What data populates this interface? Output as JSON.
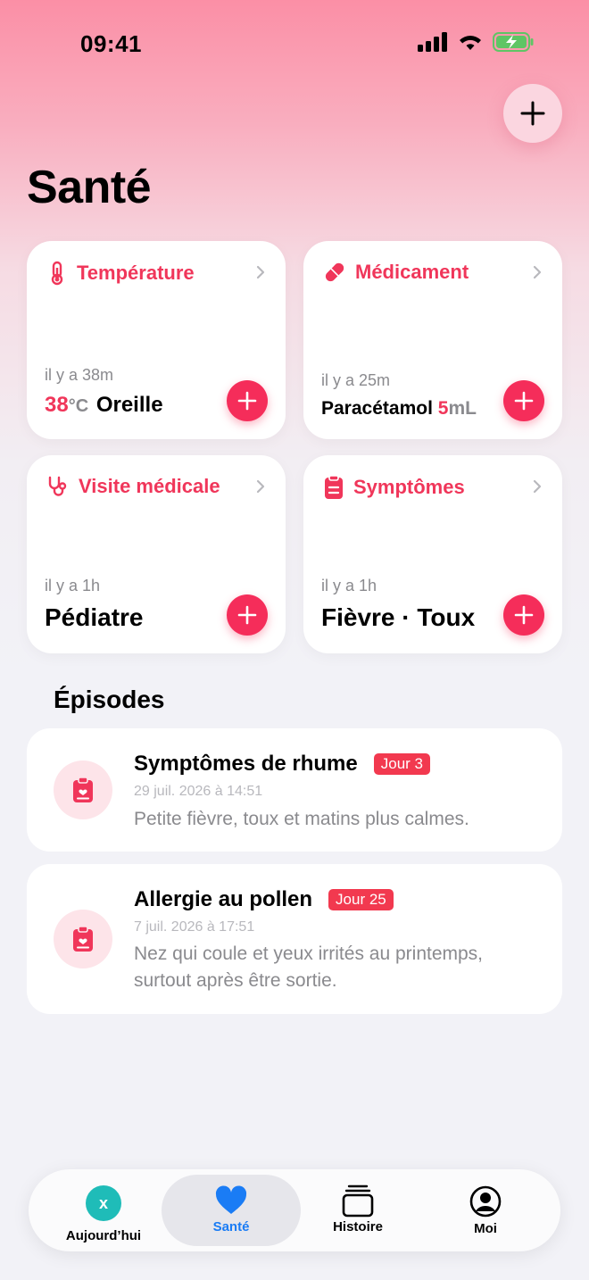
{
  "status_bar": {
    "time": "09:41"
  },
  "page": {
    "title": "Santé"
  },
  "cards": [
    {
      "label": "Température",
      "ago": "il y a 38m",
      "value_number": "38",
      "value_unit": "°C",
      "value_text": "Oreille",
      "icon": "thermometer-icon"
    },
    {
      "label": "Médicament",
      "ago": "il y a 25m",
      "value_text": "Paracétamol",
      "value_number": "5",
      "value_unit": "mL",
      "icon": "pill-icon"
    },
    {
      "label": "Visite médicale",
      "ago": "il y a 1h",
      "value_text": "Pédiatre",
      "icon": "stethoscope-icon"
    },
    {
      "label": "Symptômes",
      "ago": "il y a 1h",
      "value_text": "Fièvre · Toux",
      "icon": "clipboard-icon"
    }
  ],
  "episodes_section": {
    "title": "Épisodes"
  },
  "episodes": [
    {
      "title": "Symptômes de rhume",
      "badge": "Jour 3",
      "date": "29 juil. 2026 à 14:51",
      "description": "Petite fièvre, toux et matins plus calmes."
    },
    {
      "title": "Allergie au pollen",
      "badge": "Jour 25",
      "date": "7 juil. 2026 à 17:51",
      "description": "Nez qui coule et yeux irrités au printemps, surtout après être sortie."
    }
  ],
  "tabbar": {
    "avatar_letter": "x",
    "tabs": [
      {
        "label": "Aujourd’hui"
      },
      {
        "label": "Santé"
      },
      {
        "label": "Histoire"
      },
      {
        "label": "Moi"
      }
    ]
  },
  "colors": {
    "accent": "#f52d5a",
    "label": "#f0365a",
    "badge": "#f2394f",
    "teal": "#1fbcb8"
  }
}
